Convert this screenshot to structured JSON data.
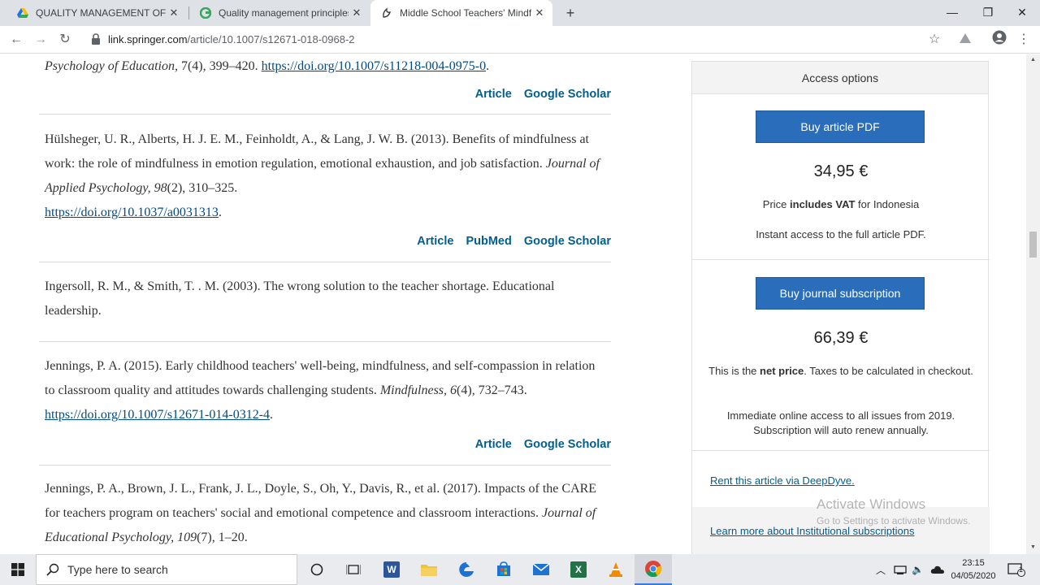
{
  "browser": {
    "tabs": [
      {
        "title": "QUALITY MANAGEMENT OF EDU",
        "icon": "google-drive-icon",
        "active": false
      },
      {
        "title": "Quality management principles a",
        "icon": "site-favicon-icon",
        "active": false
      },
      {
        "title": "Middle School Teachers' Mindful",
        "icon": "springer-favicon-icon",
        "active": true
      }
    ],
    "url_host": "link.springer.com",
    "url_path": "/article/10.1007/s12671-018-0968-2"
  },
  "references": [
    {
      "text_italic": "Psychology of Education,",
      "text_rest": " 7(4), 399–420. ",
      "doi": "https://doi.org/10.1007/s11218-004-0975-0",
      "after_doi": ".",
      "links": [
        "Article",
        "Google Scholar"
      ]
    },
    {
      "text": "Hülsheger, U. R., Alberts, H. J. E. M., Feinholdt, A., & Lang, J. W. B. (2013). Benefits of mindfulness at work: the role of mindfulness in emotion regulation, emotional exhaustion, and job satisfaction. ",
      "journal": "Journal of Applied Psychology, 98",
      "issue": "(2), 310–325.",
      "doi": "https://doi.org/10.1037/a0031313",
      "after_doi": ".",
      "links": [
        "Article",
        "PubMed",
        "Google Scholar"
      ]
    },
    {
      "text": "Ingersoll, R. M., & Smith, T. . M. (2003). The wrong solution to the teacher shortage. Educational leadership."
    },
    {
      "text": "Jennings, P. A. (2015). Early childhood teachers' well-being, mindfulness, and self-compassion in relation to classroom quality and attitudes towards challenging students. ",
      "journal": "Mindfulness, 6",
      "issue": "(4), 732–743. ",
      "doi": "https://doi.org/10.1007/s12671-014-0312-4",
      "after_doi": ".",
      "links": [
        "Article",
        "Google Scholar"
      ]
    },
    {
      "text": "Jennings, P. A., Brown, J. L., Frank, J. L., Doyle, S., Oh, Y., Davis, R., et al. (2017). Impacts of the CARE for teachers program on teachers' social and emotional competence and classroom interactions. ",
      "journal": "Journal of Educational Psychology, 109",
      "issue": "(7), 1–20."
    }
  ],
  "access": {
    "header": "Access options",
    "buy_pdf_label": "Buy article PDF",
    "pdf_price": "34,95 €",
    "pdf_vat_pre": "Price ",
    "pdf_vat_bold": "includes VAT",
    "pdf_vat_post": " for Indonesia",
    "pdf_instant": "Instant access to the full article PDF.",
    "buy_sub_label": "Buy journal subscription",
    "sub_price": "66,39 €",
    "sub_net_pre": "This is the ",
    "sub_net_bold": "net price",
    "sub_net_post": ". Taxes to be calculated in checkout.",
    "sub_access": "Immediate online access to all issues from 2019. Subscription will auto renew annually.",
    "deepdyve": "Rent this article via DeepDyve.",
    "institutional": "Learn more about Institutional subscriptions"
  },
  "watermark": {
    "line1": "Activate Windows",
    "line2": "Go to Settings to activate Windows."
  },
  "taskbar": {
    "search_placeholder": "Type here to search",
    "time": "23:15",
    "date": "04/05/2020",
    "notification_count": "1"
  },
  "colors": {
    "link": "#025e8d",
    "button": "#2a6ebb"
  }
}
